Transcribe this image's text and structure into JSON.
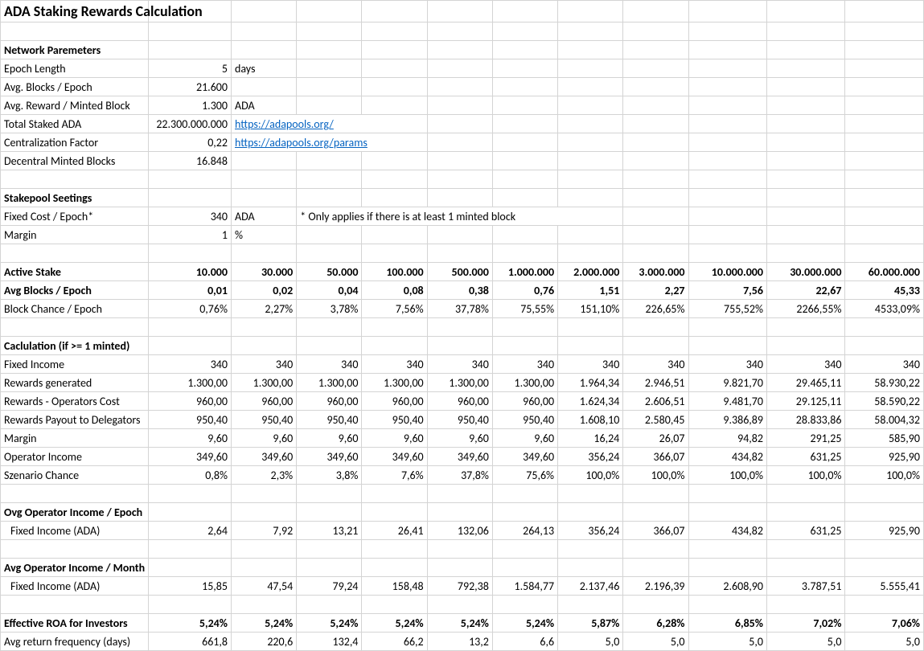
{
  "title": "ADA Staking Rewards Calculation",
  "section_network": "Network Paremeters",
  "network": {
    "epoch_label": "Epoch Length",
    "epoch_val": "5",
    "epoch_unit": "days",
    "blocks_label": "Avg. Blocks / Epoch",
    "blocks_val": "21.600",
    "reward_label": "Avg. Reward / Minted Block",
    "reward_val": "1.300",
    "reward_unit": "ADA",
    "staked_label": "Total Staked ADA",
    "staked_val": "22.300.000.000",
    "staked_link": "https://adapools.org/",
    "cf_label": "Centralization Factor",
    "cf_val": "0,22",
    "cf_link": "https://adapools.org/params",
    "dmb_label": "Decentral Minted Blocks",
    "dmb_val": "16.848"
  },
  "section_stakepool": "Stakepool Seetings",
  "stakepool": {
    "fixed_label": "Fixed Cost / Epoch*",
    "fixed_val": "340",
    "fixed_unit": "ADA",
    "fixed_note": "* Only applies if there is at least 1 minted block",
    "margin_label": "Margin",
    "margin_val": "1",
    "margin_unit": "%"
  },
  "cols": [
    "10.000",
    "30.000",
    "50.000",
    "100.000",
    "500.000",
    "1.000.000",
    "2.000.000",
    "3.000.000",
    "10.000.000",
    "30.000.000",
    "60.000.000"
  ],
  "row_active_stake": "Active Stake",
  "row_avg_blocks": "Avg Blocks / Epoch",
  "avg_blocks": [
    "0,01",
    "0,02",
    "0,04",
    "0,08",
    "0,38",
    "0,76",
    "1,51",
    "2,27",
    "7,56",
    "22,67",
    "45,33"
  ],
  "row_block_chance": "Block Chance / Epoch",
  "block_chance": [
    "0,76%",
    "2,27%",
    "3,78%",
    "7,56%",
    "37,78%",
    "75,55%",
    "151,10%",
    "226,65%",
    "755,52%",
    "2266,55%",
    "4533,09%"
  ],
  "section_calc": "Caclulation (if >= 1 minted)",
  "row_fixed_income": "Fixed Income",
  "fixed_income": [
    "340",
    "340",
    "340",
    "340",
    "340",
    "340",
    "340",
    "340",
    "340",
    "340",
    "340"
  ],
  "row_rewards_gen": "Rewards generated",
  "rewards_gen": [
    "1.300,00",
    "1.300,00",
    "1.300,00",
    "1.300,00",
    "1.300,00",
    "1.300,00",
    "1.964,34",
    "2.946,51",
    "9.821,70",
    "29.465,11",
    "58.930,22"
  ],
  "row_rewards_op": "Rewards - Operators Cost",
  "rewards_op": [
    "960,00",
    "960,00",
    "960,00",
    "960,00",
    "960,00",
    "960,00",
    "1.624,34",
    "2.606,51",
    "9.481,70",
    "29.125,11",
    "58.590,22"
  ],
  "row_rewards_del": "Rewards Payout to Delegators",
  "rewards_del": [
    "950,40",
    "950,40",
    "950,40",
    "950,40",
    "950,40",
    "950,40",
    "1.608,10",
    "2.580,45",
    "9.386,89",
    "28.833,86",
    "58.004,32"
  ],
  "row_margin": "Margin",
  "margin": [
    "9,60",
    "9,60",
    "9,60",
    "9,60",
    "9,60",
    "9,60",
    "16,24",
    "26,07",
    "94,82",
    "291,25",
    "585,90"
  ],
  "row_op_income": "Operator Income",
  "op_income": [
    "349,60",
    "349,60",
    "349,60",
    "349,60",
    "349,60",
    "349,60",
    "356,24",
    "366,07",
    "434,82",
    "631,25",
    "925,90"
  ],
  "row_scenario": "Szenario Chance",
  "scenario": [
    "0,8%",
    "2,3%",
    "3,8%",
    "7,6%",
    "37,8%",
    "75,6%",
    "100,0%",
    "100,0%",
    "100,0%",
    "100,0%",
    "100,0%"
  ],
  "section_ovg_epoch": "Ovg Operator Income / Epoch",
  "row_fixed_ada1": "   Fixed Income (ADA)",
  "fixed_ada1": [
    "2,64",
    "7,92",
    "13,21",
    "26,41",
    "132,06",
    "264,13",
    "356,24",
    "366,07",
    "434,82",
    "631,25",
    "925,90"
  ],
  "section_avg_month": "Avg Operator Income / Month",
  "row_fixed_ada2": "   Fixed Income (ADA)",
  "fixed_ada2": [
    "15,85",
    "47,54",
    "79,24",
    "158,48",
    "792,38",
    "1.584,77",
    "2.137,46",
    "2.196,39",
    "2.608,90",
    "3.787,51",
    "5.555,41"
  ],
  "row_roa": "Effective ROA for Investors",
  "roa": [
    "5,24%",
    "5,24%",
    "5,24%",
    "5,24%",
    "5,24%",
    "5,24%",
    "5,87%",
    "6,28%",
    "6,85%",
    "7,02%",
    "7,06%"
  ],
  "row_freq": "Avg return frequency (days)",
  "freq": [
    "661,8",
    "220,6",
    "132,4",
    "66,2",
    "13,2",
    "6,6",
    "5,0",
    "5,0",
    "5,0",
    "5,0",
    "5,0"
  ]
}
